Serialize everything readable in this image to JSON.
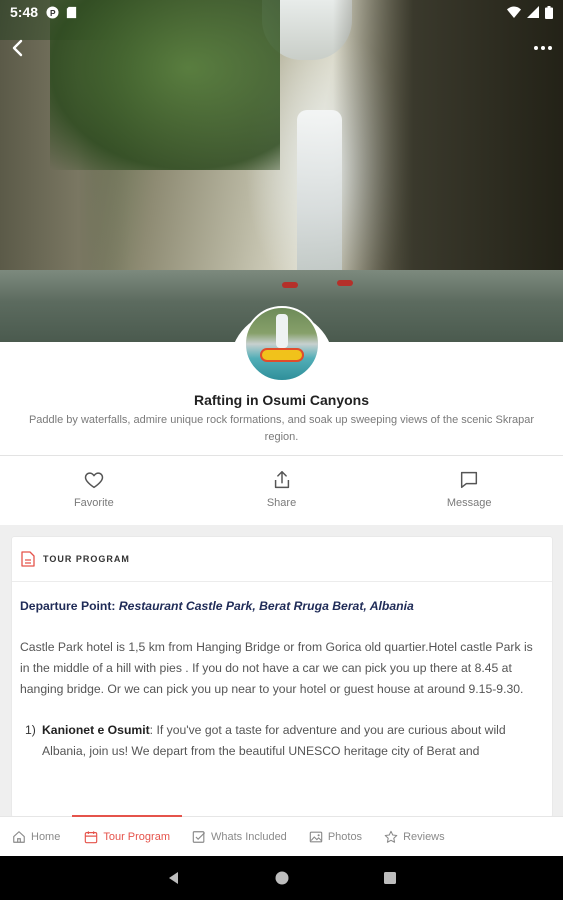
{
  "status_bar": {
    "time": "5:48"
  },
  "tour": {
    "title": "Rafting in Osumi Canyons",
    "subtitle": "Paddle by waterfalls, admire unique rock formations, and soak up sweeping views of the scenic Skrapar region."
  },
  "actions": [
    {
      "label": "Favorite",
      "icon": "heart-icon"
    },
    {
      "label": "Share",
      "icon": "share-icon"
    },
    {
      "label": "Message",
      "icon": "message-icon"
    }
  ],
  "program": {
    "header": "TOUR PROGRAM",
    "departure_label": "Departure Point:",
    "departure_value": "Restaurant Castle Park, Berat Rruga Berat, Albania",
    "intro": "Castle Park hotel is 1,5 km from Hanging Bridge or from Gorica old quartier.Hotel castle Park is in the middle of a hill with pies . If you do not have a car we can pick you up there at 8.45 at hanging bridge. Or we can pick you up near to your hotel or guest house at around 9.15-9.30.",
    "items": [
      {
        "number": "1)",
        "title": "Kanionet e Osumit",
        "text": ": If you've got a taste for adventure and you are curious about wild Albania, join us! We depart from the beautiful UNESCO heritage city of Berat and"
      }
    ]
  },
  "tabs": [
    {
      "label": "Home",
      "icon": "home-icon",
      "active": false
    },
    {
      "label": "Tour Program",
      "icon": "calendar-icon",
      "active": true
    },
    {
      "label": "Whats Included",
      "icon": "checkbox-icon",
      "active": false
    },
    {
      "label": "Photos",
      "icon": "image-icon",
      "active": false
    },
    {
      "label": "Reviews",
      "icon": "star-icon",
      "active": false
    }
  ],
  "colors": {
    "accent": "#e5534b",
    "departure_text": "#1f2b57"
  }
}
